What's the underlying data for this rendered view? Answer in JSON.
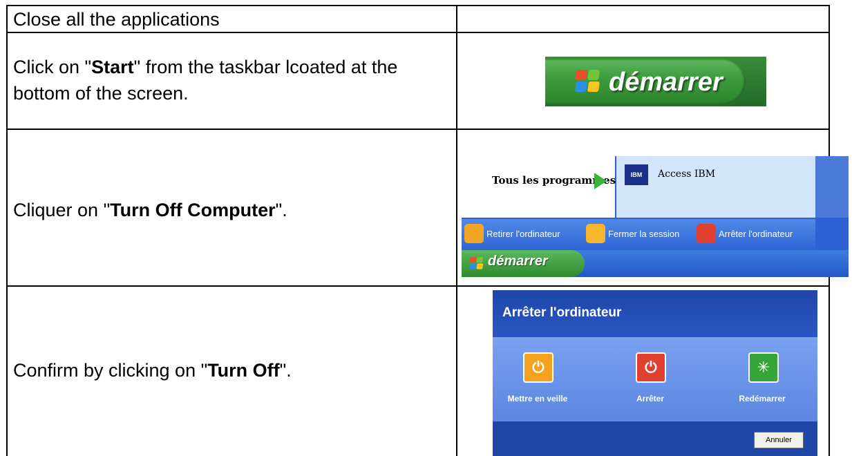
{
  "rows": [
    {
      "text": "Close all the applications"
    },
    {
      "pre": "Click on \"",
      "bold": "Start",
      "post": "\" from the taskbar lcoated at the bottom of the screen."
    },
    {
      "pre": "Cliquer on \"",
      "bold": "Turn Off Computer",
      "post": "\"."
    },
    {
      "pre": "Confirm by clicking on \"",
      "bold": "Turn Off",
      "post": "\"."
    }
  ],
  "start_button": {
    "label": "démarrer"
  },
  "start_menu": {
    "all_programs": "Tous les programmes",
    "pinned_item": "Access IBM",
    "ibm_logo": "IBM",
    "bottom_items": [
      "Retirer l'ordinateur",
      "Fermer la session",
      "Arrêter l'ordinateur"
    ],
    "taskbar_start": "démarrer"
  },
  "shutdown_dialog": {
    "title": "Arrêter l'ordinateur",
    "options": [
      "Mettre en veille",
      "Arrêter",
      "Redémarrer"
    ],
    "cancel": "Annuler"
  },
  "colors": {
    "xp_blue": "#2d62d3",
    "start_green": "#3e9d3e",
    "standby_orange": "#f4a21d",
    "turnoff_red": "#e0402f",
    "restart_green": "#37a43a"
  }
}
